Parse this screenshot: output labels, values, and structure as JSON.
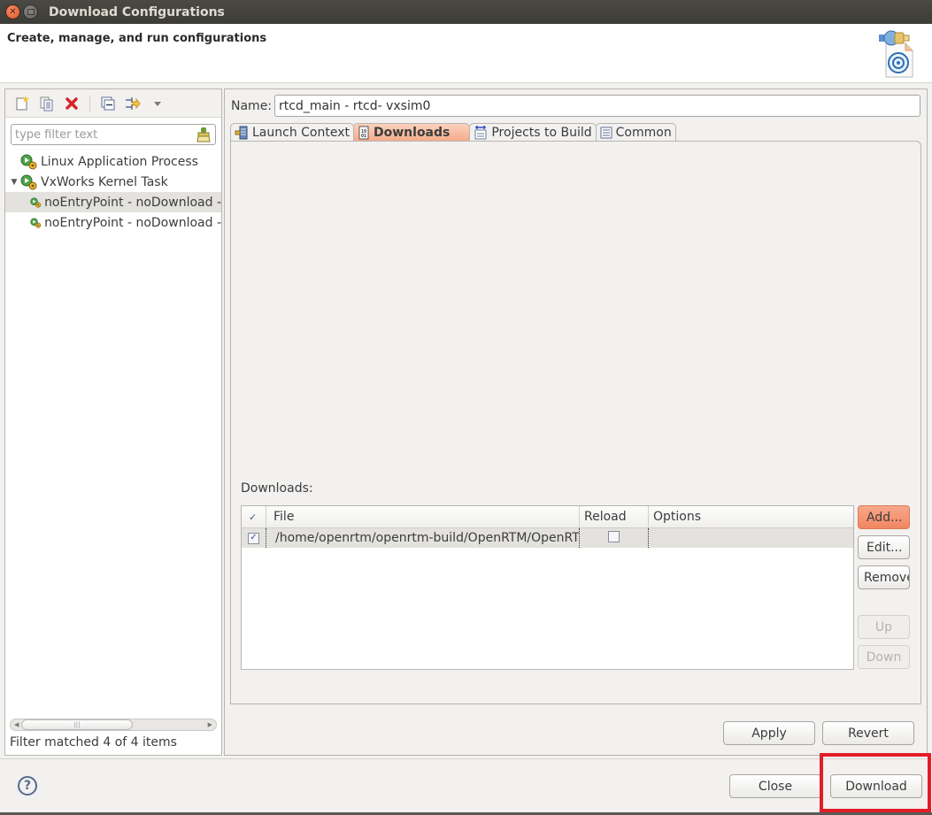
{
  "window": {
    "title": "Download Configurations",
    "close_icon": "close-icon",
    "maximize_icon": "maximize-icon"
  },
  "header": {
    "description": "Create, manage, and run configurations",
    "icon": "download-configuration-banner-icon"
  },
  "left_panel": {
    "toolbar": [
      {
        "name": "new-configuration",
        "icon": "new-document-icon"
      },
      {
        "name": "duplicate-configuration",
        "icon": "duplicate-icon"
      },
      {
        "name": "delete-configuration",
        "icon": "delete-x-icon"
      },
      {
        "name": "collapse-all",
        "icon": "collapse-all-icon"
      },
      {
        "name": "filter-configurations",
        "icon": "filter-arrow-icon"
      },
      {
        "name": "view-menu",
        "icon": "dropdown-triangle-icon"
      }
    ],
    "filter": {
      "placeholder": "type filter text",
      "value": ""
    },
    "tree": [
      {
        "label": "Linux Application Process",
        "level": 0,
        "expanded": null,
        "selected": false
      },
      {
        "label": "VxWorks Kernel Task",
        "level": 0,
        "expanded": true,
        "selected": false
      },
      {
        "label": "noEntryPoint - noDownload -",
        "level": 1,
        "expanded": null,
        "selected": true
      },
      {
        "label": "noEntryPoint - noDownload -",
        "level": 1,
        "expanded": null,
        "selected": false
      }
    ],
    "status": "Filter matched 4 of 4 items"
  },
  "right_panel": {
    "name_label": "Name:",
    "name_value": "rtcd_main - rtcd- vxsim0",
    "tabs": [
      {
        "label": "Launch Context",
        "icon": "launch-context-icon",
        "active": false
      },
      {
        "label": "Downloads",
        "icon": "binary-file-icon",
        "active": true
      },
      {
        "label": "Projects to Build",
        "icon": "projects-build-icon",
        "active": false
      },
      {
        "label": "Common",
        "icon": "common-list-icon",
        "active": false
      }
    ],
    "downloads": {
      "label": "Downloads:",
      "columns": [
        "✓",
        "File",
        "Reload",
        "Options"
      ],
      "rows": [
        {
          "checked": true,
          "file": "/home/openrtm/openrtm-build/OpenRTM/OpenRT",
          "reload": false,
          "options": ""
        }
      ],
      "buttons": {
        "add": "Add...",
        "edit": "Edit...",
        "remove": "Remove",
        "up": "Up",
        "down": "Down"
      }
    },
    "apply": "Apply",
    "revert": "Revert"
  },
  "footer": {
    "help_icon": "help-question-icon",
    "help_glyph": "?",
    "close": "Close",
    "download": "Download"
  },
  "colors": {
    "accent": "#f18661",
    "highlight_box": "#e31d26",
    "titlebar": "#3d3c37"
  }
}
